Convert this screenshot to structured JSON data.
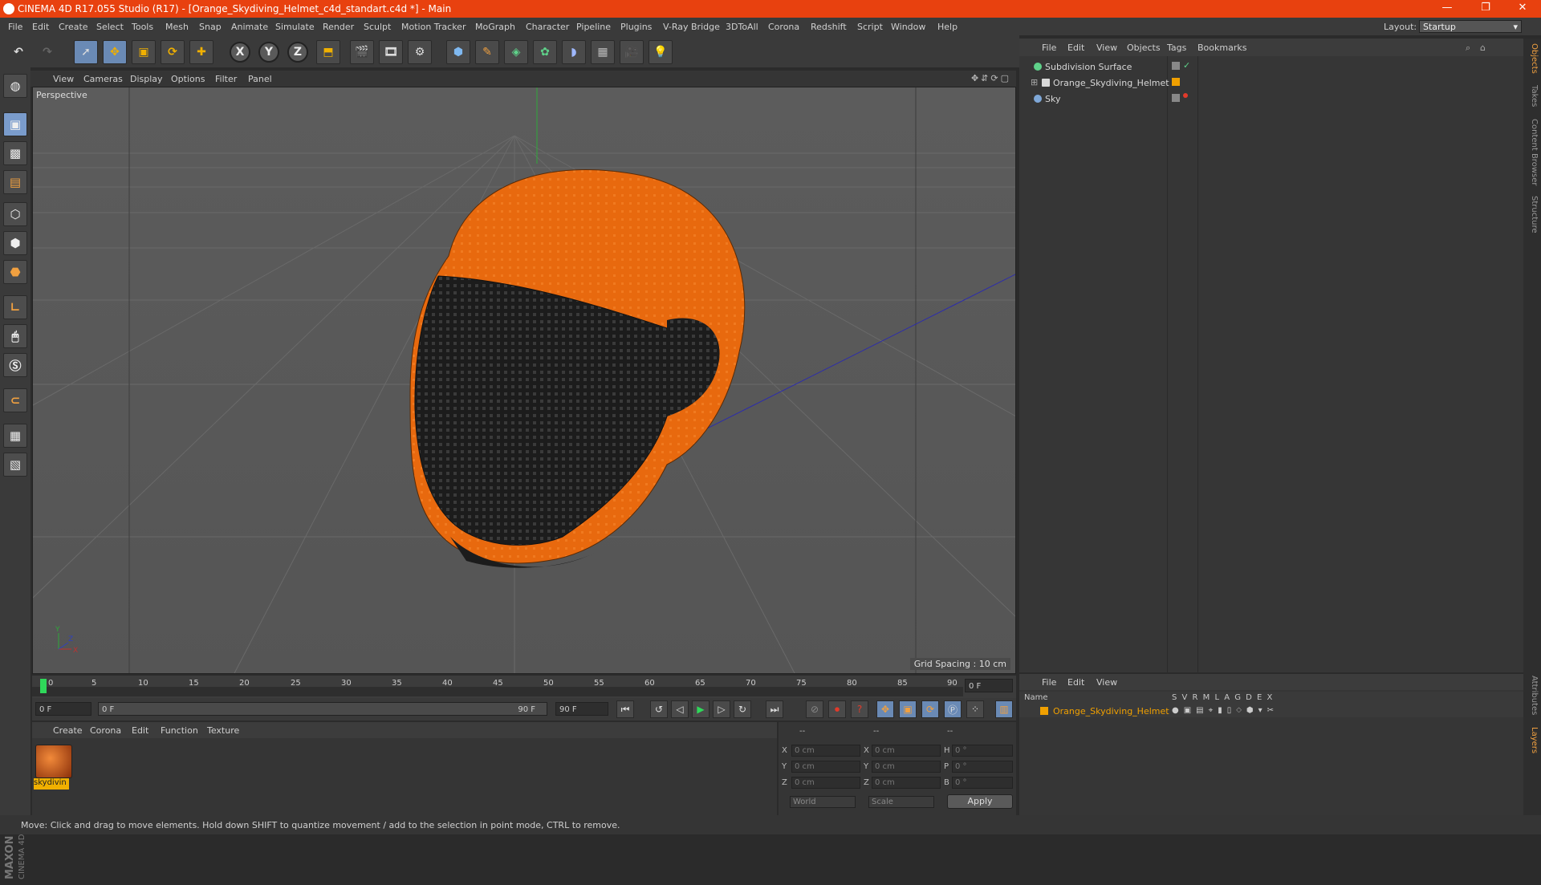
{
  "window": {
    "title": "CINEMA 4D R17.055 Studio (R17) - [Orange_Skydiving_Helmet_c4d_standart.c4d *] - Main",
    "controls": [
      "—",
      "❐",
      "✕"
    ]
  },
  "menubar": {
    "items": [
      "File",
      "Edit",
      "Create",
      "Select",
      "Tools",
      "Mesh",
      "Snap",
      "Animate",
      "Simulate",
      "Render",
      "Sculpt",
      "Motion Tracker",
      "MoGraph",
      "Character",
      "Pipeline",
      "Plugins",
      "V-Ray Bridge",
      "3DToAll",
      "Corona",
      "Redshift",
      "Script",
      "Window",
      "Help"
    ],
    "layout_label": "Layout:",
    "layout_value": "Startup"
  },
  "toolbar": {
    "axis_x": "X",
    "axis_y": "Y",
    "axis_z": "Z",
    "icons": [
      "undo-icon",
      "redo-icon",
      "select-icon",
      "move-icon",
      "scale-icon",
      "rotate-icon",
      "add-icon",
      "coord-icon",
      "render-view-icon",
      "render-picture-icon",
      "edit-render-icon",
      "cube-icon",
      "pen-icon",
      "subdivision-icon",
      "cloner-icon",
      "deformer-icon",
      "floor-icon",
      "camera-icon",
      "light-icon"
    ]
  },
  "viewport": {
    "menu": [
      "View",
      "Cameras",
      "Display",
      "Options",
      "Filter",
      "Panel"
    ],
    "label": "Perspective",
    "grid_spacing": "Grid Spacing : 10 cm",
    "axis_y": "Y",
    "axis_x": "X",
    "axis_z": "Z",
    "nav_icons": "✥⇵⟳▢"
  },
  "timeline": {
    "ticks": [
      "0",
      "5",
      "10",
      "15",
      "20",
      "25",
      "30",
      "35",
      "40",
      "45",
      "50",
      "55",
      "60",
      "65",
      "70",
      "75",
      "80",
      "85",
      "90"
    ],
    "current_frame": "0 F",
    "start_field": "0 F",
    "slider_start": "0 F",
    "slider_end": "90 F",
    "end_field": "90 F"
  },
  "material_panel": {
    "menu": [
      "Create",
      "Corona",
      "Edit",
      "Function",
      "Texture"
    ],
    "material_name": "skydivin"
  },
  "coord_panel": {
    "headers": [
      "--",
      "--",
      "--"
    ],
    "rows": [
      {
        "a": "X",
        "a_val": "0 cm",
        "b": "X",
        "b_val": "0 cm",
        "c": "H",
        "c_val": "0 °"
      },
      {
        "a": "Y",
        "a_val": "0 cm",
        "b": "Y",
        "b_val": "0 cm",
        "c": "P",
        "c_val": "0 °"
      },
      {
        "a": "Z",
        "a_val": "0 cm",
        "b": "Z",
        "b_val": "0 cm",
        "c": "B",
        "c_val": "0 °"
      }
    ],
    "world_select": "World",
    "scale_select": "Scale",
    "apply": "Apply"
  },
  "object_manager": {
    "menu": [
      "File",
      "Edit",
      "View",
      "Objects",
      "Tags",
      "Bookmarks"
    ],
    "objects": [
      {
        "name": "Subdivision Surface",
        "icon_color": "#5fd28a"
      },
      {
        "name": "Orange_Skydiving_Helmet",
        "icon_color": "#d8d8d8"
      },
      {
        "name": "Sky",
        "icon_color": "#7fa8d8"
      }
    ]
  },
  "layer_manager": {
    "menu": [
      "File",
      "Edit",
      "View"
    ],
    "columns_name": "Name",
    "columns_flags": "S V R M L A G D E X",
    "layer_name": "Orange_Skydiving_Helmet",
    "layer_color": "#f0a000"
  },
  "right_tabs": [
    "Objects",
    "Takes",
    "Content Browser",
    "Structure",
    "Attributes",
    "Layers"
  ],
  "status": {
    "text": "Move: Click and drag to move elements. Hold down SHIFT to quantize movement / add to the selection in point mode, CTRL to remove."
  },
  "brand": {
    "line1": "MAXON",
    "line2": "CINEMA 4D"
  },
  "colors": {
    "accent": "#e8410f",
    "helmet": "#e86a10",
    "visor": "#1e1e1e",
    "selection": "#6a8ab5"
  }
}
